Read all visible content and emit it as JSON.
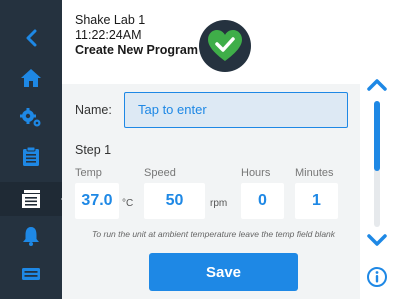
{
  "header": {
    "device_name": "Shake Lab 1",
    "time": "11:22:24AM",
    "screen_title": "Create New Program"
  },
  "sidebar": {
    "items": [
      {
        "icon": "chevron-left-icon"
      },
      {
        "icon": "home-icon"
      },
      {
        "icon": "gears-icon"
      },
      {
        "icon": "clipboard-icon"
      },
      {
        "icon": "program-list-icon",
        "active": true
      },
      {
        "icon": "bell-icon"
      },
      {
        "icon": "device-icon"
      }
    ]
  },
  "form": {
    "name_label": "Name:",
    "name_placeholder": "Tap to enter",
    "step_title": "Step 1",
    "temp_label": "Temp",
    "temp_value": "37.0",
    "temp_unit": "°C",
    "speed_label": "Speed",
    "speed_value": "50",
    "speed_unit": "rpm",
    "hours_label": "Hours",
    "hours_value": "0",
    "minutes_label": "Minutes",
    "minutes_value": "1",
    "hint": "To run the unit at ambient temperature leave the temp field blank"
  },
  "actions": {
    "save_label": "Save"
  },
  "colors": {
    "sidebar": "#25323f",
    "accent": "#1e88e5",
    "logo_heart": "#3fae49",
    "background": "#f2f4f5"
  }
}
